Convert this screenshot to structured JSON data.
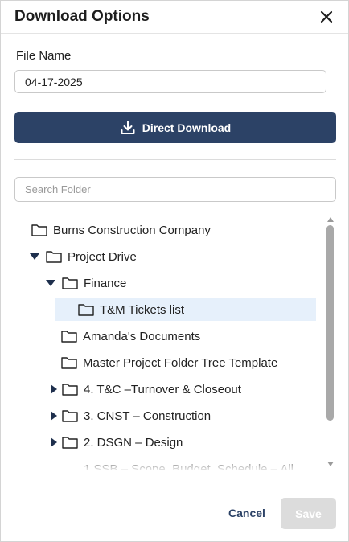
{
  "dialog": {
    "title": "Download Options",
    "close_icon": "close-icon"
  },
  "file_name": {
    "label": "File Name",
    "value": "04-17-2025"
  },
  "direct_download": {
    "label": "Direct Download",
    "icon": "download-icon"
  },
  "search": {
    "placeholder": "Search Folder"
  },
  "tree": {
    "items": [
      {
        "label": "Burns Construction Company",
        "caret": "none"
      },
      {
        "label": "Project Drive",
        "caret": "expanded"
      },
      {
        "label": "Finance",
        "caret": "expanded"
      },
      {
        "label": "T&M Tickets list",
        "caret": "none",
        "selected": true
      },
      {
        "label": "Amanda's Documents",
        "caret": "none"
      },
      {
        "label": "Master Project Folder Tree Template",
        "caret": "none"
      },
      {
        "label": "4. T&C –Turnover & Closeout",
        "caret": "collapsed"
      },
      {
        "label": "3. CNST – Construction",
        "caret": "collapsed"
      },
      {
        "label": "2. DSGN – Design",
        "caret": "collapsed"
      },
      {
        "label": "1.SSB – Scope, Budget, Schedule – All",
        "caret": "collapsed"
      }
    ]
  },
  "footer": {
    "cancel_label": "Cancel",
    "save_label": "Save"
  },
  "colors": {
    "primary": "#2c4266",
    "selected_row": "#e6f0fb",
    "disabled_button": "#dcdcdc"
  }
}
